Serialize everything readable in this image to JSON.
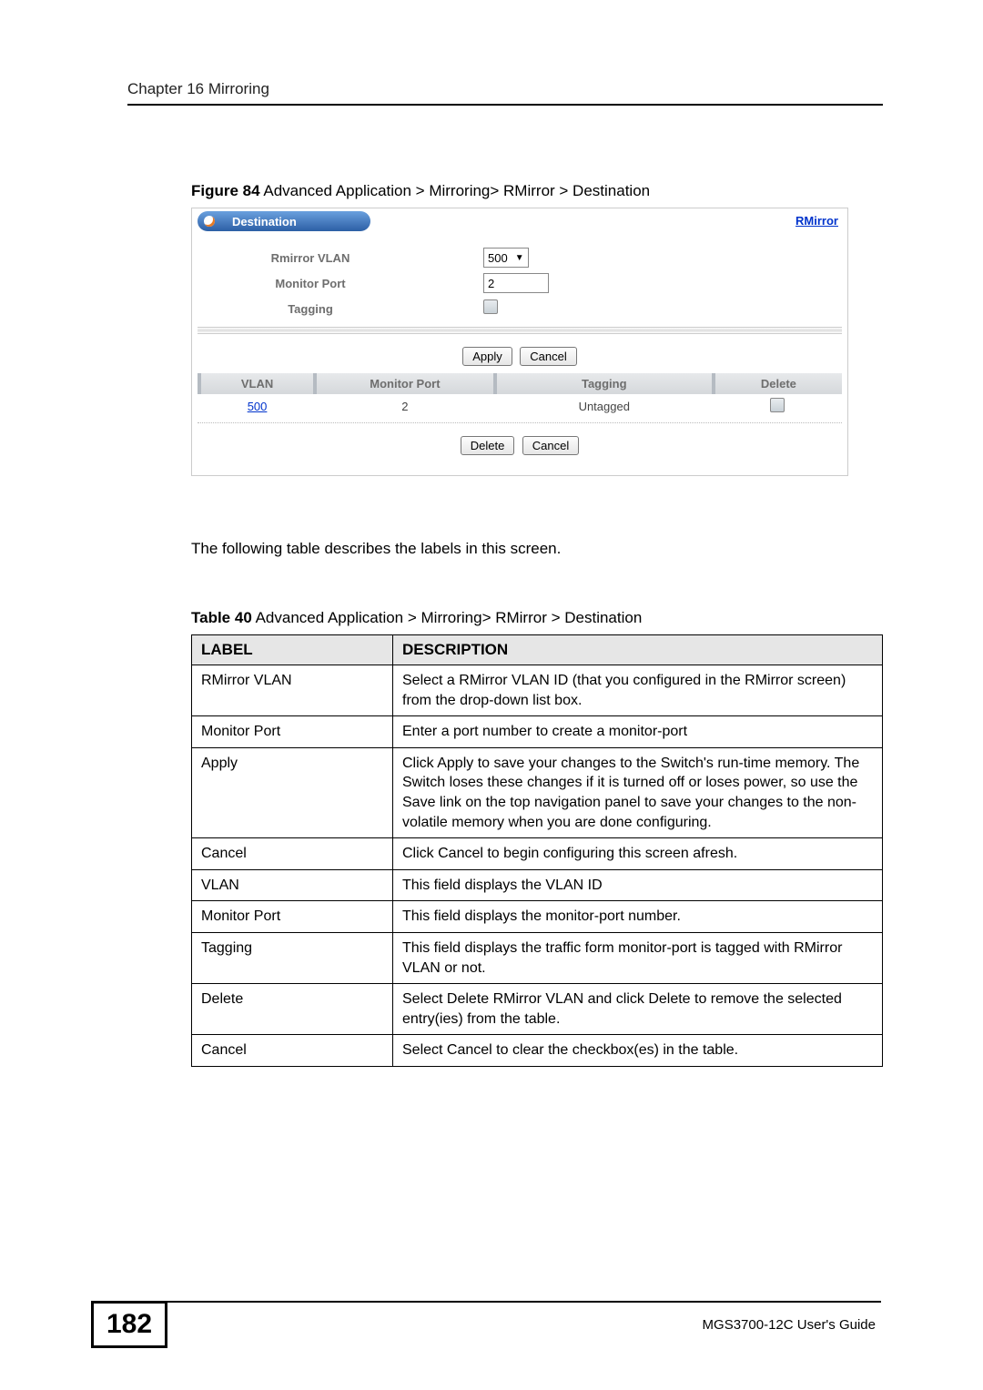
{
  "header": {
    "chapter_label": "Chapter 16 Mirroring"
  },
  "figure": {
    "label_bold": "Figure 84",
    "label_rest": "   Advanced Application > Mirroring> RMirror > Destination"
  },
  "ui": {
    "title": "Destination",
    "title_link": "RMirror",
    "form": {
      "rmirror_vlan_label": "Rmirror VLAN",
      "rmirror_vlan_value": "500",
      "monitor_port_label": "Monitor Port",
      "monitor_port_value": "2",
      "tagging_label": "Tagging"
    },
    "buttons": {
      "apply": "Apply",
      "cancel": "Cancel",
      "delete": "Delete"
    },
    "table": {
      "headers": {
        "vlan": "VLAN",
        "monitor_port": "Monitor Port",
        "tagging": "Tagging",
        "delete": "Delete"
      },
      "row": {
        "vlan": "500",
        "monitor_port": "2",
        "tagging": "Untagged"
      }
    }
  },
  "intro_text": "The following table describes the labels in this screen.",
  "table_caption": {
    "label_bold": "Table 40",
    "label_rest": "   Advanced Application > Mirroring> RMirror > Destination"
  },
  "desc": {
    "header_label": "LABEL",
    "header_desc": "DESCRIPTION",
    "rows": [
      {
        "label": "RMirror VLAN",
        "desc": "Select a RMirror VLAN ID (that you configured in the RMirror screen) from the drop-down list box."
      },
      {
        "label": "Monitor Port",
        "desc": "Enter a port number to create a monitor-port"
      },
      {
        "label": "Apply",
        "desc": "Click Apply to save your changes to the Switch's run-time memory. The Switch loses these changes if it is turned off or loses power, so use the Save link on the top navigation panel to save your changes to the non-volatile memory when you are done configuring."
      },
      {
        "label": "Cancel",
        "desc": "Click Cancel to begin configuring this screen afresh."
      },
      {
        "label": "VLAN",
        "desc": "This field displays the VLAN ID"
      },
      {
        "label": "Monitor Port",
        "desc": "This field displays the monitor-port number."
      },
      {
        "label": "Tagging",
        "desc": "This field displays the traffic form monitor-port is tagged with RMirror VLAN or not."
      },
      {
        "label": "Delete",
        "desc": "Select Delete RMirror VLAN and click Delete to remove the selected entry(ies) from the table."
      },
      {
        "label": "Cancel",
        "desc": "Select Cancel to clear the checkbox(es) in the table."
      }
    ]
  },
  "footer": {
    "page_number": "182",
    "guide_text": "MGS3700-12C User's Guide"
  }
}
